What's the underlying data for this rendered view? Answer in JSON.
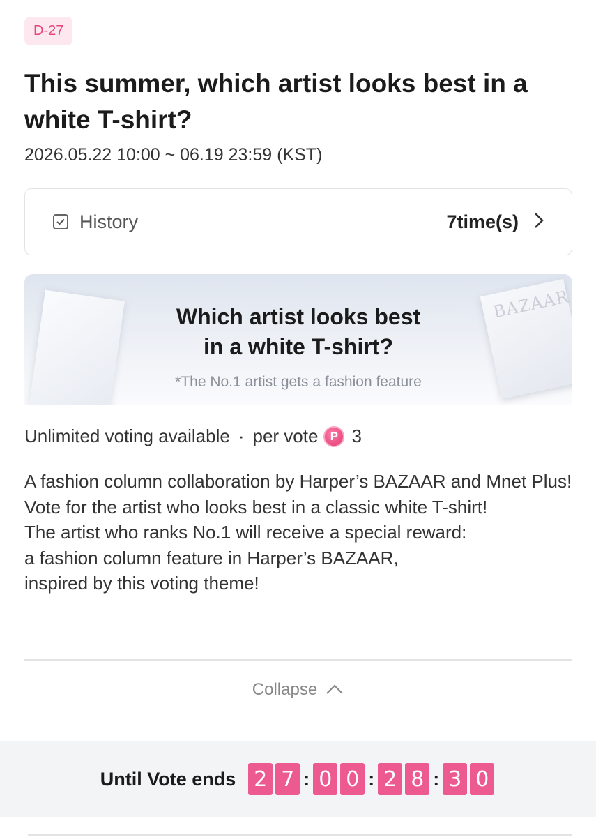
{
  "badge": "D-27",
  "title": "This summer, which artist looks best in a white T-shirt?",
  "date_range": "2026.05.22 10:00 ~ 06.19 23:59 (KST)",
  "history": {
    "label": "History",
    "count": "7time(s)"
  },
  "banner": {
    "title_line1": "Which artist looks best",
    "title_line2": "in a white T-shirt?",
    "subtitle": "*The No.1 artist gets a fashion feature",
    "magazine_logo": "BAZAAR"
  },
  "voting": {
    "availability": "Unlimited voting available",
    "separator": "·",
    "per_vote_label": "per vote",
    "point_symbol": "P",
    "cost": "3"
  },
  "description": [
    "A fashion column collaboration by Harper’s BAZAAR and Mnet Plus!",
    "Vote for the artist who looks best in a classic white T-shirt!",
    "The artist who ranks No.1 will receive a special reward:",
    "a fashion column feature in Harper’s BAZAAR,",
    "inspired by this voting theme!"
  ],
  "collapse_label": "Collapse",
  "countdown": {
    "label": "Until Vote ends",
    "days": [
      "2",
      "7"
    ],
    "hours": [
      "0",
      "0"
    ],
    "minutes": [
      "2",
      "8"
    ],
    "seconds": [
      "3",
      "0"
    ],
    "colon": ":"
  },
  "colors": {
    "accent": "#ec5a8f",
    "badge_bg": "#fde8ef",
    "badge_text": "#e8447c"
  }
}
